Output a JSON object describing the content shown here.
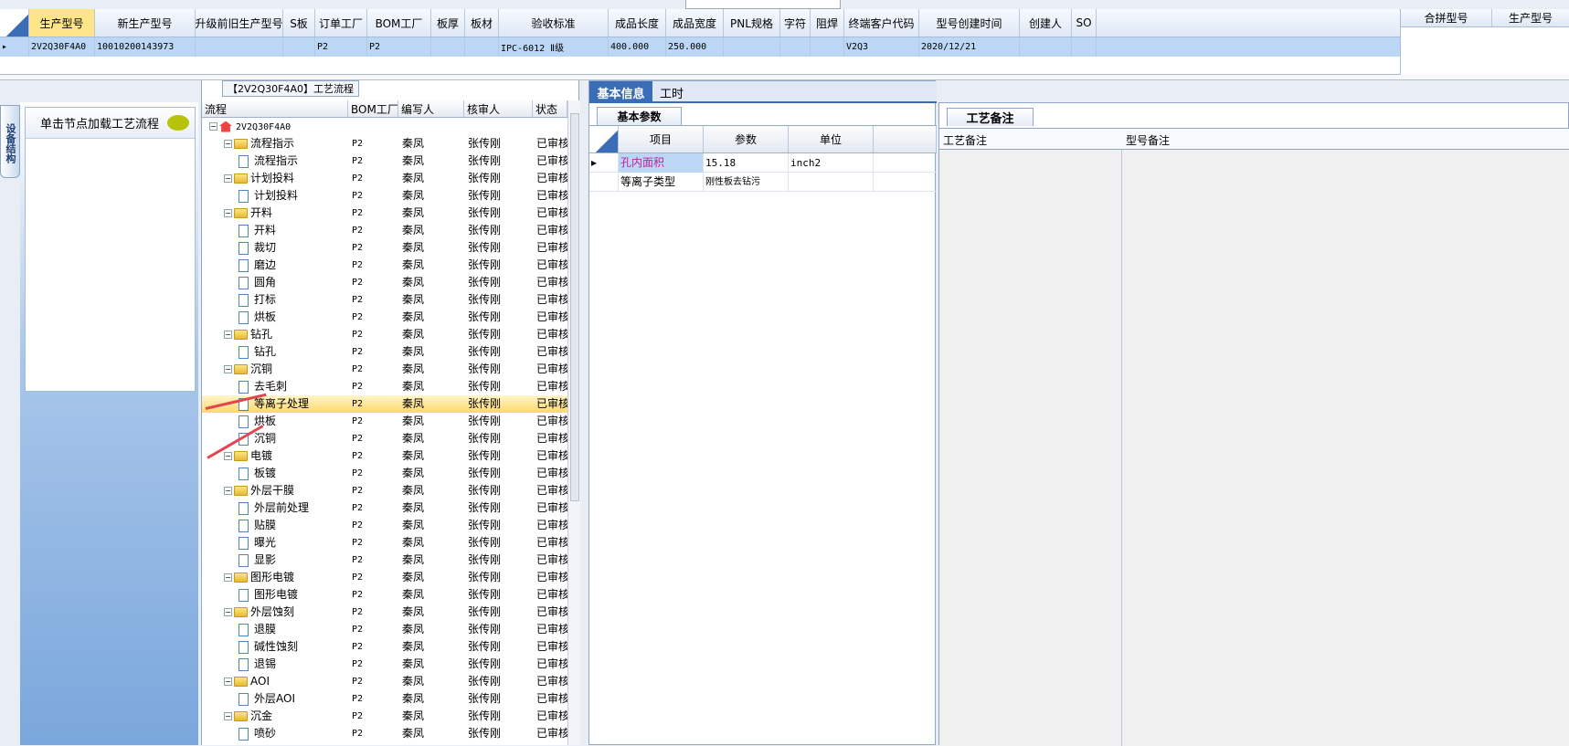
{
  "top_grid": {
    "headers": [
      "生产型号",
      "新生产型号",
      "升级前旧生产型号",
      "S板",
      "订单工厂",
      "BOM工厂",
      "板厚",
      "板材",
      "验收标准",
      "成品长度",
      "成品宽度",
      "PNL规格",
      "字符",
      "阻焊",
      "终端客户代码",
      "型号创建时间",
      "创建人",
      "SO"
    ],
    "row": [
      "2V2Q30F4A0",
      "10010200143973",
      "",
      "",
      "P2",
      "P2",
      "",
      "",
      "IPC-6012 Ⅱ级",
      "400.000",
      "250.000",
      "",
      "",
      "",
      "V2Q3",
      "2020/12/21",
      "",
      ""
    ]
  },
  "right_grid": {
    "headers": [
      "合拼型号",
      "生产型号"
    ]
  },
  "left_side_tab": "设备结构",
  "hint": "单击节点加载工艺流程",
  "tree": {
    "title": "【2V2Q30F4A0】工艺流程",
    "headers": [
      "流程",
      "BOM工厂",
      "编写人",
      "核审人",
      "状态"
    ],
    "rows": [
      {
        "label": "2V2Q30F4A0",
        "level": 0,
        "type": "root",
        "factory": "",
        "writer": "",
        "checker": "",
        "status": ""
      },
      {
        "label": "流程指示",
        "level": 1,
        "type": "folder",
        "factory": "P2",
        "writer": "秦凤",
        "checker": "张传刚",
        "status": "已审核"
      },
      {
        "label": "流程指示",
        "level": 2,
        "type": "doc",
        "factory": "P2",
        "writer": "秦凤",
        "checker": "张传刚",
        "status": "已审核"
      },
      {
        "label": "计划投料",
        "level": 1,
        "type": "folder",
        "factory": "P2",
        "writer": "秦凤",
        "checker": "张传刚",
        "status": "已审核"
      },
      {
        "label": "计划投料",
        "level": 2,
        "type": "doc",
        "factory": "P2",
        "writer": "秦凤",
        "checker": "张传刚",
        "status": "已审核"
      },
      {
        "label": "开料",
        "level": 1,
        "type": "folder",
        "factory": "P2",
        "writer": "秦凤",
        "checker": "张传刚",
        "status": "已审核"
      },
      {
        "label": "开料",
        "level": 2,
        "type": "doc",
        "factory": "P2",
        "writer": "秦凤",
        "checker": "张传刚",
        "status": "已审核"
      },
      {
        "label": "裁切",
        "level": 2,
        "type": "doc",
        "factory": "P2",
        "writer": "秦凤",
        "checker": "张传刚",
        "status": "已审核"
      },
      {
        "label": "磨边",
        "level": 2,
        "type": "doc",
        "factory": "P2",
        "writer": "秦凤",
        "checker": "张传刚",
        "status": "已审核"
      },
      {
        "label": "圆角",
        "level": 2,
        "type": "doc",
        "factory": "P2",
        "writer": "秦凤",
        "checker": "张传刚",
        "status": "已审核"
      },
      {
        "label": "打标",
        "level": 2,
        "type": "doc",
        "factory": "P2",
        "writer": "秦凤",
        "checker": "张传刚",
        "status": "已审核"
      },
      {
        "label": "烘板",
        "level": 2,
        "type": "doc",
        "factory": "P2",
        "writer": "秦凤",
        "checker": "张传刚",
        "status": "已审核"
      },
      {
        "label": "钻孔",
        "level": 1,
        "type": "folder",
        "factory": "P2",
        "writer": "秦凤",
        "checker": "张传刚",
        "status": "已审核"
      },
      {
        "label": "钻孔",
        "level": 2,
        "type": "doc",
        "factory": "P2",
        "writer": "秦凤",
        "checker": "张传刚",
        "status": "已审核"
      },
      {
        "label": "沉铜",
        "level": 1,
        "type": "folder",
        "factory": "P2",
        "writer": "秦凤",
        "checker": "张传刚",
        "status": "已审核"
      },
      {
        "label": "去毛刺",
        "level": 2,
        "type": "doc",
        "factory": "P2",
        "writer": "秦凤",
        "checker": "张传刚",
        "status": "已审核"
      },
      {
        "label": "等离子处理",
        "level": 2,
        "type": "doc",
        "factory": "P2",
        "writer": "秦凤",
        "checker": "张传刚",
        "status": "已审核",
        "selected": true
      },
      {
        "label": "烘板",
        "level": 2,
        "type": "doc",
        "factory": "P2",
        "writer": "秦凤",
        "checker": "张传刚",
        "status": "已审核"
      },
      {
        "label": "沉铜",
        "level": 2,
        "type": "doc",
        "factory": "P2",
        "writer": "秦凤",
        "checker": "张传刚",
        "status": "已审核"
      },
      {
        "label": "电镀",
        "level": 1,
        "type": "folder",
        "factory": "P2",
        "writer": "秦凤",
        "checker": "张传刚",
        "status": "已审核"
      },
      {
        "label": "板镀",
        "level": 2,
        "type": "doc",
        "factory": "P2",
        "writer": "秦凤",
        "checker": "张传刚",
        "status": "已审核"
      },
      {
        "label": "外层干膜",
        "level": 1,
        "type": "folder",
        "factory": "P2",
        "writer": "秦凤",
        "checker": "张传刚",
        "status": "已审核"
      },
      {
        "label": "外层前处理",
        "level": 2,
        "type": "doc",
        "factory": "P2",
        "writer": "秦凤",
        "checker": "张传刚",
        "status": "已审核"
      },
      {
        "label": "贴膜",
        "level": 2,
        "type": "doc",
        "factory": "P2",
        "writer": "秦凤",
        "checker": "张传刚",
        "status": "已审核"
      },
      {
        "label": "曝光",
        "level": 2,
        "type": "doc",
        "factory": "P2",
        "writer": "秦凤",
        "checker": "张传刚",
        "status": "已审核"
      },
      {
        "label": "显影",
        "level": 2,
        "type": "doc",
        "factory": "P2",
        "writer": "秦凤",
        "checker": "张传刚",
        "status": "已审核"
      },
      {
        "label": "图形电镀",
        "level": 1,
        "type": "folder",
        "factory": "P2",
        "writer": "秦凤",
        "checker": "张传刚",
        "status": "已审核"
      },
      {
        "label": "图形电镀",
        "level": 2,
        "type": "doc",
        "factory": "P2",
        "writer": "秦凤",
        "checker": "张传刚",
        "status": "已审核"
      },
      {
        "label": "外层蚀刻",
        "level": 1,
        "type": "folder",
        "factory": "P2",
        "writer": "秦凤",
        "checker": "张传刚",
        "status": "已审核"
      },
      {
        "label": "退膜",
        "level": 2,
        "type": "doc",
        "factory": "P2",
        "writer": "秦凤",
        "checker": "张传刚",
        "status": "已审核"
      },
      {
        "label": "碱性蚀刻",
        "level": 2,
        "type": "doc",
        "factory": "P2",
        "writer": "秦凤",
        "checker": "张传刚",
        "status": "已审核"
      },
      {
        "label": "退锡",
        "level": 2,
        "type": "doc",
        "factory": "P2",
        "writer": "秦凤",
        "checker": "张传刚",
        "status": "已审核"
      },
      {
        "label": "AOI",
        "level": 1,
        "type": "folder",
        "factory": "P2",
        "writer": "秦凤",
        "checker": "张传刚",
        "status": "已审核"
      },
      {
        "label": "外层AOI",
        "level": 2,
        "type": "doc",
        "factory": "P2",
        "writer": "秦凤",
        "checker": "张传刚",
        "status": "已审核"
      },
      {
        "label": "沉金",
        "level": 1,
        "type": "folder",
        "factory": "P2",
        "writer": "秦凤",
        "checker": "张传刚",
        "status": "已审核"
      },
      {
        "label": "喷砂",
        "level": 2,
        "type": "doc",
        "factory": "P2",
        "writer": "秦凤",
        "checker": "张传刚",
        "status": "已审核"
      }
    ]
  },
  "tabs": [
    "基本信息",
    "工时"
  ],
  "basic_params": {
    "tab": "基本参数",
    "headers": [
      "项目",
      "参数",
      "单位"
    ],
    "rows": [
      {
        "item": "孔内面积",
        "param": "15.18",
        "unit": "inch2"
      },
      {
        "item": "等离子类型",
        "param": "刚性板去钻污",
        "unit": ""
      }
    ]
  },
  "process_notes": {
    "tab": "工艺备注",
    "headers": [
      "工艺备注",
      "型号备注"
    ]
  },
  "colors": {
    "selected_row": "#bcd7f5",
    "highlight": "#ffd86b",
    "tab_active": "#3a6db5",
    "arrow": "#e0464e",
    "item_text": "#c0209a"
  }
}
